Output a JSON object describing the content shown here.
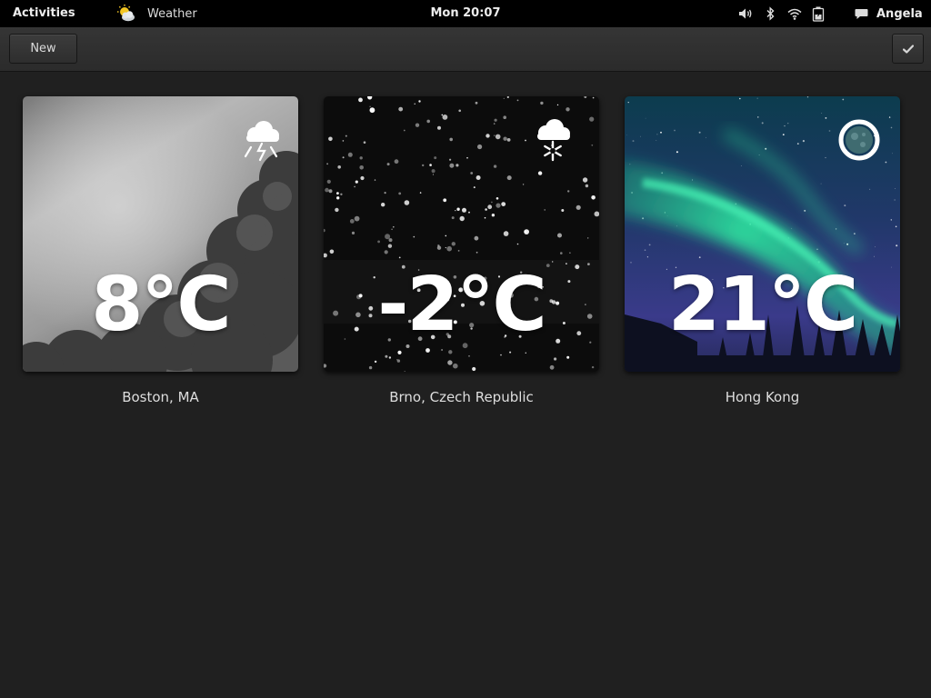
{
  "topbar": {
    "activities": "Activities",
    "app_name": "Weather",
    "clock": "Mon 20:07",
    "user_name": "Angela"
  },
  "toolbar": {
    "new_label": "New",
    "done_icon": "checkmark-icon"
  },
  "locations": [
    {
      "city": "Boston, MA",
      "temperature": "8°C",
      "condition_icon": "thunderstorm-icon"
    },
    {
      "city": "Brno, Czech Republic",
      "temperature": "-2°C",
      "condition_icon": "snow-icon"
    },
    {
      "city": "Hong Kong",
      "temperature": "21°C",
      "condition_icon": "clear-night-icon"
    }
  ],
  "colors": {
    "topbar_bg": "#000000",
    "window_bg": "#202020",
    "aurora_green": "#2ee5a0"
  }
}
